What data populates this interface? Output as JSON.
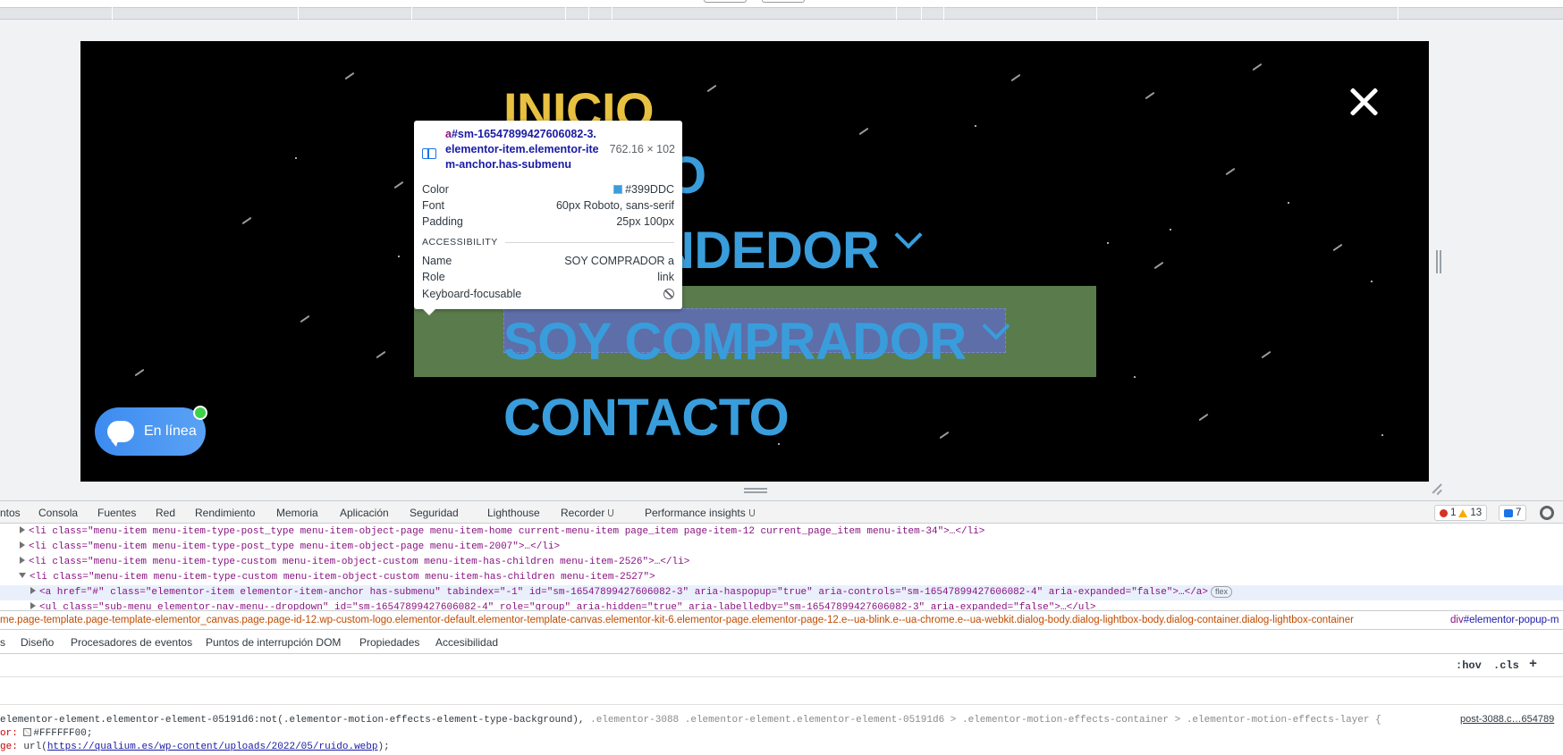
{
  "menu": {
    "items": [
      {
        "label": "INICIO"
      },
      {
        "label": "O"
      },
      {
        "label": "NDEDOR"
      },
      {
        "label": "SOY COMPRADOR"
      },
      {
        "label": "CONTACTO"
      }
    ],
    "color": "#399DDC",
    "active_color": "#E8C141"
  },
  "chat_widget": {
    "label": "En línea"
  },
  "tooltip": {
    "selector_tag": "a",
    "selector_rest": "#sm-16547899427606082-3.elementor-item.elementor-item-anchor.has-submenu",
    "dimensions": "762.16 × 102",
    "rows": [
      {
        "key": "Color",
        "value": "#399DDC"
      },
      {
        "key": "Font",
        "value": "60px Roboto, sans-serif"
      },
      {
        "key": "Padding",
        "value": "25px 100px"
      }
    ],
    "section": "ACCESSIBILITY",
    "a11y": [
      {
        "key": "Name",
        "value": "SOY COMPRADOR a"
      },
      {
        "key": "Role",
        "value": "link"
      },
      {
        "key": "Keyboard-focusable",
        "value": ""
      }
    ]
  },
  "devtools": {
    "tabs": [
      "ntos",
      "Consola",
      "Fuentes",
      "Red",
      "Rendimiento",
      "Memoria",
      "Aplicación",
      "Seguridad",
      "Lighthouse",
      "Recorder",
      "Performance insights"
    ],
    "errors": "1",
    "warnings": "13",
    "messages": "7",
    "dom_lines": [
      "<li class=\"menu-item menu-item-type-post_type menu-item-object-page menu-item-home current-menu-item page_item page-item-12 current_page_item menu-item-34\">…</li>",
      "<li class=\"menu-item menu-item-type-post_type menu-item-object-page menu-item-2007\">…</li>",
      "<li class=\"menu-item menu-item-type-custom menu-item-object-custom menu-item-has-children menu-item-2526\">…</li>",
      "<li class=\"menu-item menu-item-type-custom menu-item-object-custom menu-item-has-children menu-item-2527\">",
      "<a href=\"#\" class=\"elementor-item elementor-item-anchor has-submenu\" tabindex=\"-1\" id=\"sm-16547899427606082-3\" aria-haspopup=\"true\" aria-controls=\"sm-16547899427606082-4\" aria-expanded=\"false\">…</a>",
      "<ul class=\"sub-menu elementor-nav-menu--dropdown\" id=\"sm-16547899427606082-4\" role=\"group\" aria-hidden=\"true\" aria-labelledby=\"sm-16547899427606082-3\" aria-expanded=\"false\">…</ul>"
    ],
    "dom_pill": "flex",
    "breadcrumb_left": "me.page-template.page-template-elementor_canvas.page.page-id-12.wp-custom-logo.elementor-default.elementor-template-canvas.elementor-kit-6.elementor-page.elementor-page-12.e--ua-blink.e--ua-chrome.e--ua-webkit.dialog-body.dialog-lightbox-body.dialog-container.dialog-lightbox-container",
    "breadcrumb_right_tag": "div",
    "breadcrumb_right_id": "#elementor-popup-m",
    "subtabs": [
      "s",
      "Diseño",
      "Procesadores de eventos",
      "Puntos de interrupción DOM",
      "Propiedades",
      "Accesibilidad"
    ],
    "filter_buttons": [
      ":hov",
      ".cls",
      "+"
    ],
    "style_selector_dim": "elementor-element.elementor-element-05191d6:not(.elementor-motion-effects-element-type-background), .elementor-3088 .elementor-element.elementor-element-05191d6 > .elementor-motion-effects-container > .elementor-motion-effects-layer {",
    "style_selector_main": "elementor-element.elementor-element-05191d6:not(.elementor-motion-effects-element-type-background),",
    "style_selector_rest": ".elementor-3088 .elementor-element.elementor-element-05191d6 > .elementor-motion-effects-container > .elementor-motion-effects-layer {",
    "style_source": "post-3088.c…654789",
    "style_prop1_name": "or:",
    "style_prop1_value": "#FFFFFF00;",
    "style_prop2_name": "ge:",
    "style_prop2_prefix": "url(",
    "style_prop2_url": "https://qualium.es/wp-content/uploads/2022/05/ruido.webp",
    "style_prop2_suffix": ");"
  }
}
